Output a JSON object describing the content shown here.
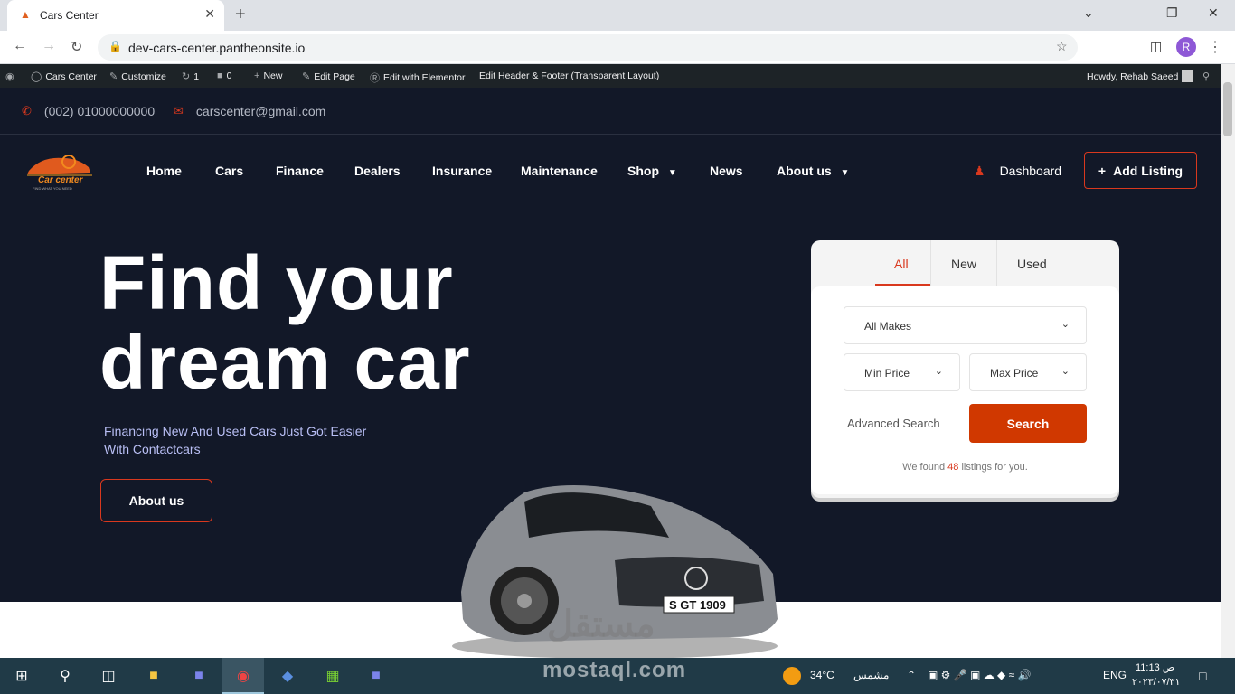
{
  "browser": {
    "tab_title": "Cars Center",
    "url": "dev-cars-center.pantheonsite.io",
    "profile_initial": "R"
  },
  "wp_admin_bar": {
    "items": [
      "Cars Center",
      "Customize",
      "1",
      "0",
      "New",
      "Edit Page",
      "Edit with Elementor",
      "Edit Header & Footer (Transparent Layout)"
    ],
    "howdy": "Howdy, Rehab Saeed"
  },
  "topbar": {
    "phone": "(002) 01000000000",
    "email": "carscenter@gmail.com"
  },
  "logo": {
    "text": "Car center",
    "tagline": "FIND WHAT YOU NEED"
  },
  "nav": {
    "items": [
      "Home",
      "Cars",
      "Finance",
      "Dealers",
      "Insurance",
      "Maintenance",
      "Shop",
      "News",
      "About us"
    ],
    "dashboard": "Dashboard",
    "add_listing": "Add Listing"
  },
  "hero": {
    "title_line1": "Find your",
    "title_line2": "dream car",
    "subtitle": "Financing New And Used Cars Just Got Easier With Contactcars",
    "button": "About us"
  },
  "search_card": {
    "tabs": [
      "All",
      "New",
      "Used"
    ],
    "active_tab": "All",
    "makes": "All Makes",
    "min_price": "Min Price",
    "max_price": "Max Price",
    "advanced": "Advanced Search",
    "search_button": "Search",
    "found_prefix": "We found",
    "found_count": "48",
    "found_suffix": "listings for you."
  },
  "car_plate": "S GT 1909",
  "watermark": {
    "arabic": "مستقل",
    "latin": "mostaql.com"
  },
  "taskbar": {
    "weather_temp": "34°C",
    "weather_label": "مشمس",
    "language": "ENG",
    "time": "11:13 ص",
    "date": "٢٠٢٣/٠٧/٣١"
  },
  "colors": {
    "accent": "#d9381e",
    "site_bg": "#121828",
    "search_btn": "#d03800"
  }
}
